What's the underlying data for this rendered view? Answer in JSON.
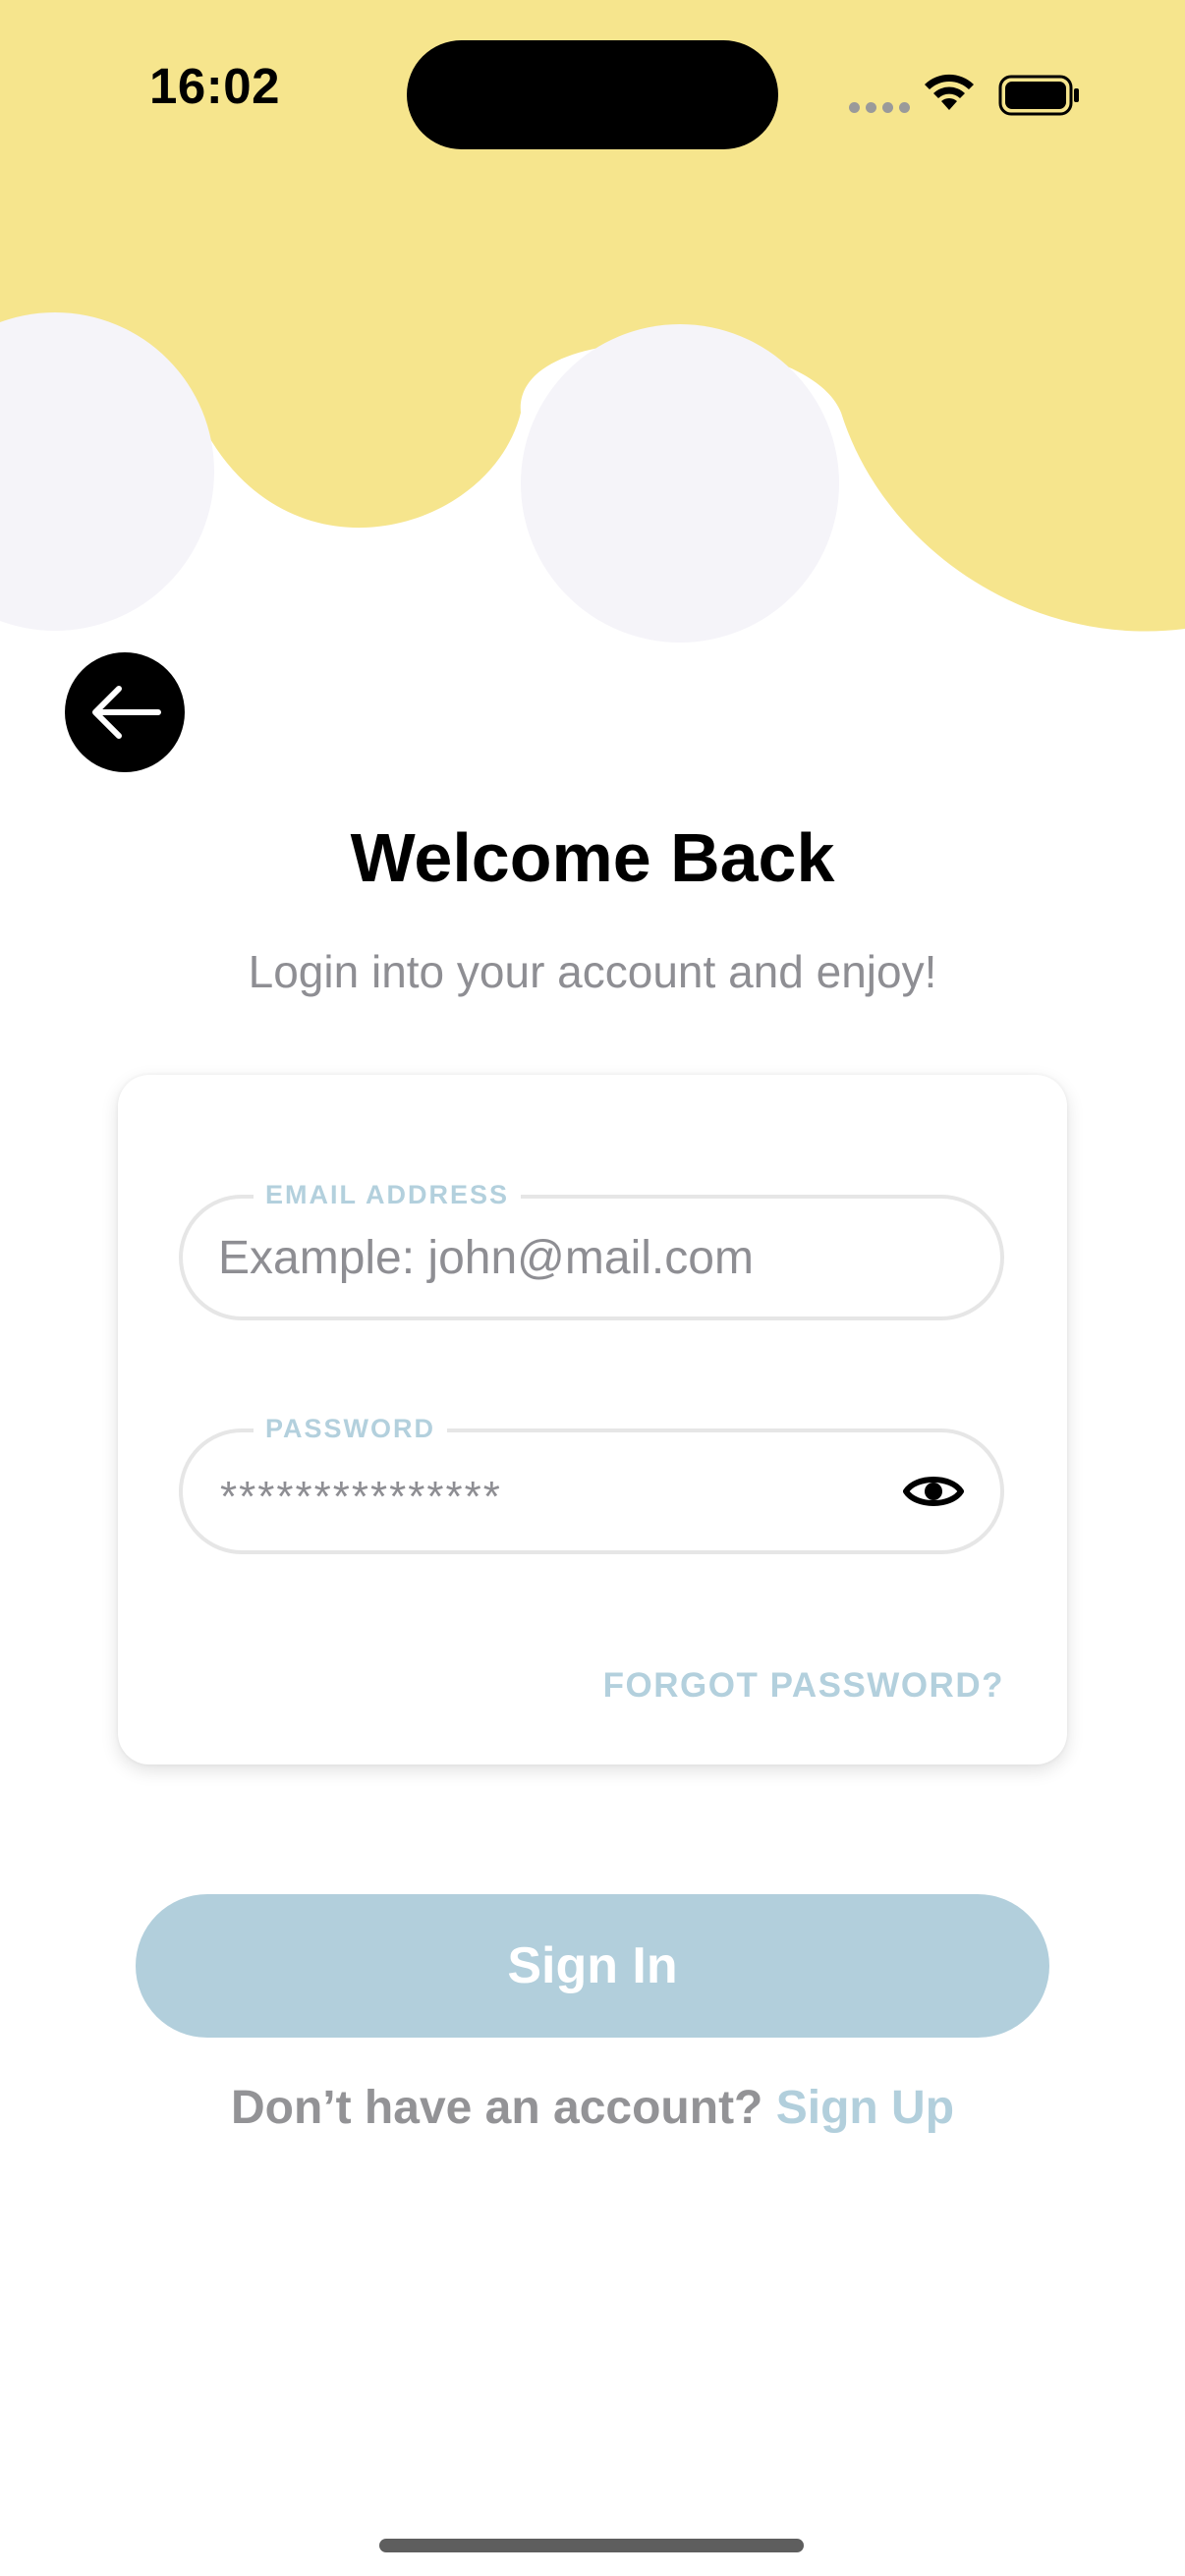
{
  "status_bar": {
    "time": "16:02"
  },
  "header": {
    "title": "Welcome Back",
    "subtitle": "Login into your account and enjoy!"
  },
  "form": {
    "email": {
      "label": "EMAIL ADDRESS",
      "placeholder": "Example: john@mail.com",
      "value": ""
    },
    "password": {
      "label": "PASSWORD",
      "masked_value": "***************"
    },
    "forgot_password": "FORGOT PASSWORD?"
  },
  "actions": {
    "sign_in": "Sign In",
    "no_account_prompt": "Don’t have an account?",
    "sign_up": "Sign Up"
  },
  "icons": {
    "back": "arrow-left-icon",
    "password_toggle": "eye-icon",
    "wifi": "wifi-icon",
    "battery": "battery-icon"
  },
  "colors": {
    "hero_yellow": "#F6E58D",
    "hero_circles": "#F5F4F9",
    "accent_blue": "#B2CFDC",
    "muted_text": "#8E8E93"
  }
}
